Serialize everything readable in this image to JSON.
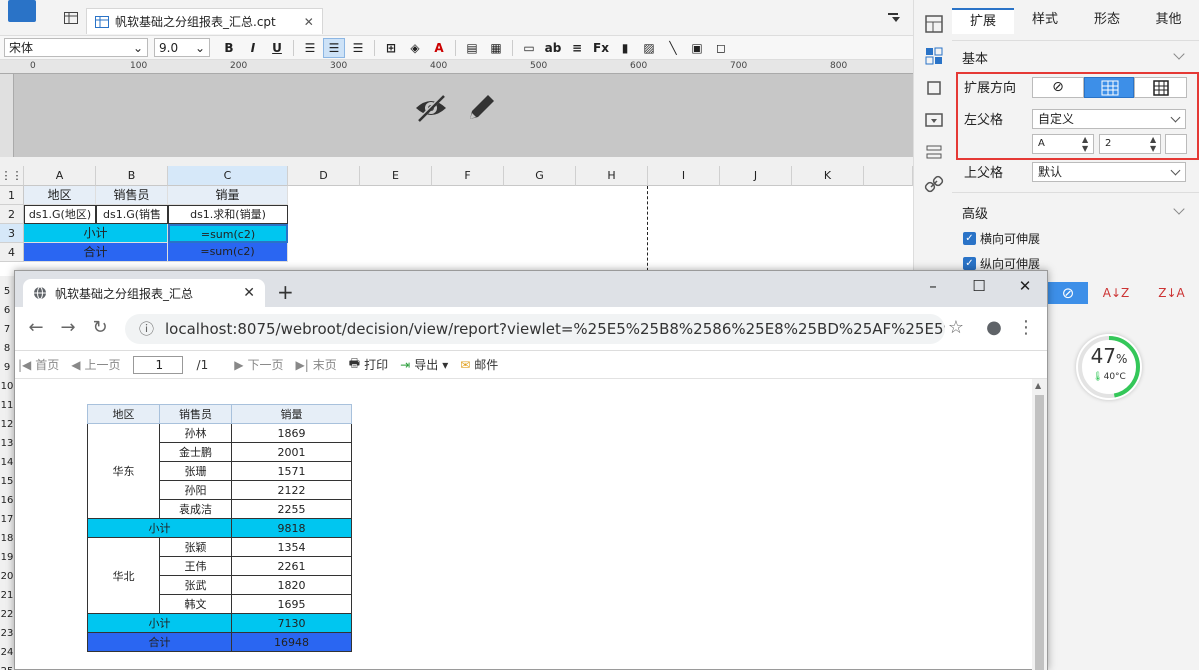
{
  "designer": {
    "file_tab": "帆软基础之分组报表_汇总.cpt",
    "font_name": "宋体",
    "font_size": "9.0",
    "bold": "B",
    "italic": "I",
    "underline": "U",
    "ruler_labels": [
      "0",
      "100",
      "200",
      "300",
      "400",
      "500",
      "600",
      "700",
      "800"
    ]
  },
  "grid": {
    "columns": [
      "A",
      "B",
      "C",
      "D",
      "E",
      "F",
      "G",
      "H",
      "I",
      "J",
      "K"
    ],
    "rows": [
      "1",
      "2",
      "3",
      "4"
    ],
    "cells": {
      "a1": "地区",
      "b1": "销售员",
      "c1": "销量",
      "a2": "ds1.G(地区)",
      "b2": "ds1.G(销售",
      "c2": "ds1.求和(销量)",
      "ab3": "小计",
      "c3": "=sum(c2)",
      "ab4": "合计",
      "c4": "=sum(c2)"
    },
    "left_rows": [
      "5",
      "6",
      "7",
      "8",
      "9",
      "10",
      "11",
      "12",
      "13",
      "14",
      "15",
      "16",
      "17",
      "18",
      "19",
      "20",
      "21",
      "22",
      "23",
      "24",
      "25"
    ]
  },
  "panel": {
    "tabs": [
      "扩展",
      "样式",
      "形态",
      "其他"
    ],
    "active_tab": "扩展",
    "basic": "基本",
    "expand_dir": "扩展方向",
    "left_parent": "左父格",
    "left_parent_value": "自定义",
    "left_col": "A",
    "left_row": "2",
    "top_parent": "上父格",
    "top_parent_value": "默认",
    "advanced": "高级",
    "h_expand": "横向可伸展",
    "v_expand": "纵向可伸展",
    "highlight_color": "#e53935"
  },
  "widget": {
    "percent": "47",
    "percent_sign": "%",
    "temp": "40°C",
    "percent_value": 0.47
  },
  "browser": {
    "tab_title": "帆软基础之分组报表_汇总",
    "url": "localhost:8075/webroot/decision/view/report?viewlet=%25E5%25B8%2586%25E8%25BD%25AF%25E5%259F%25...",
    "toolbar": {
      "first": "首页",
      "prev": "上一页",
      "page": "1",
      "of": "/1",
      "next": "下一页",
      "last": "末页",
      "print": "打印",
      "export": "导出",
      "mail": "邮件"
    },
    "report": {
      "headers": [
        "地区",
        "销售员",
        "销量"
      ],
      "groups": [
        {
          "region": "华东",
          "rows": [
            [
              "孙林",
              "1869"
            ],
            [
              "金士鹏",
              "2001"
            ],
            [
              "张珊",
              "1571"
            ],
            [
              "孙阳",
              "2122"
            ],
            [
              "袁成洁",
              "2255"
            ]
          ],
          "subtotal_label": "小计",
          "subtotal": "9818"
        },
        {
          "region": "华北",
          "rows": [
            [
              "张颖",
              "1354"
            ],
            [
              "王伟",
              "2261"
            ],
            [
              "张武",
              "1820"
            ],
            [
              "韩文",
              "1695"
            ]
          ],
          "subtotal_label": "小计",
          "subtotal": "7130"
        }
      ],
      "total_label": "合计",
      "total": "16948"
    }
  }
}
